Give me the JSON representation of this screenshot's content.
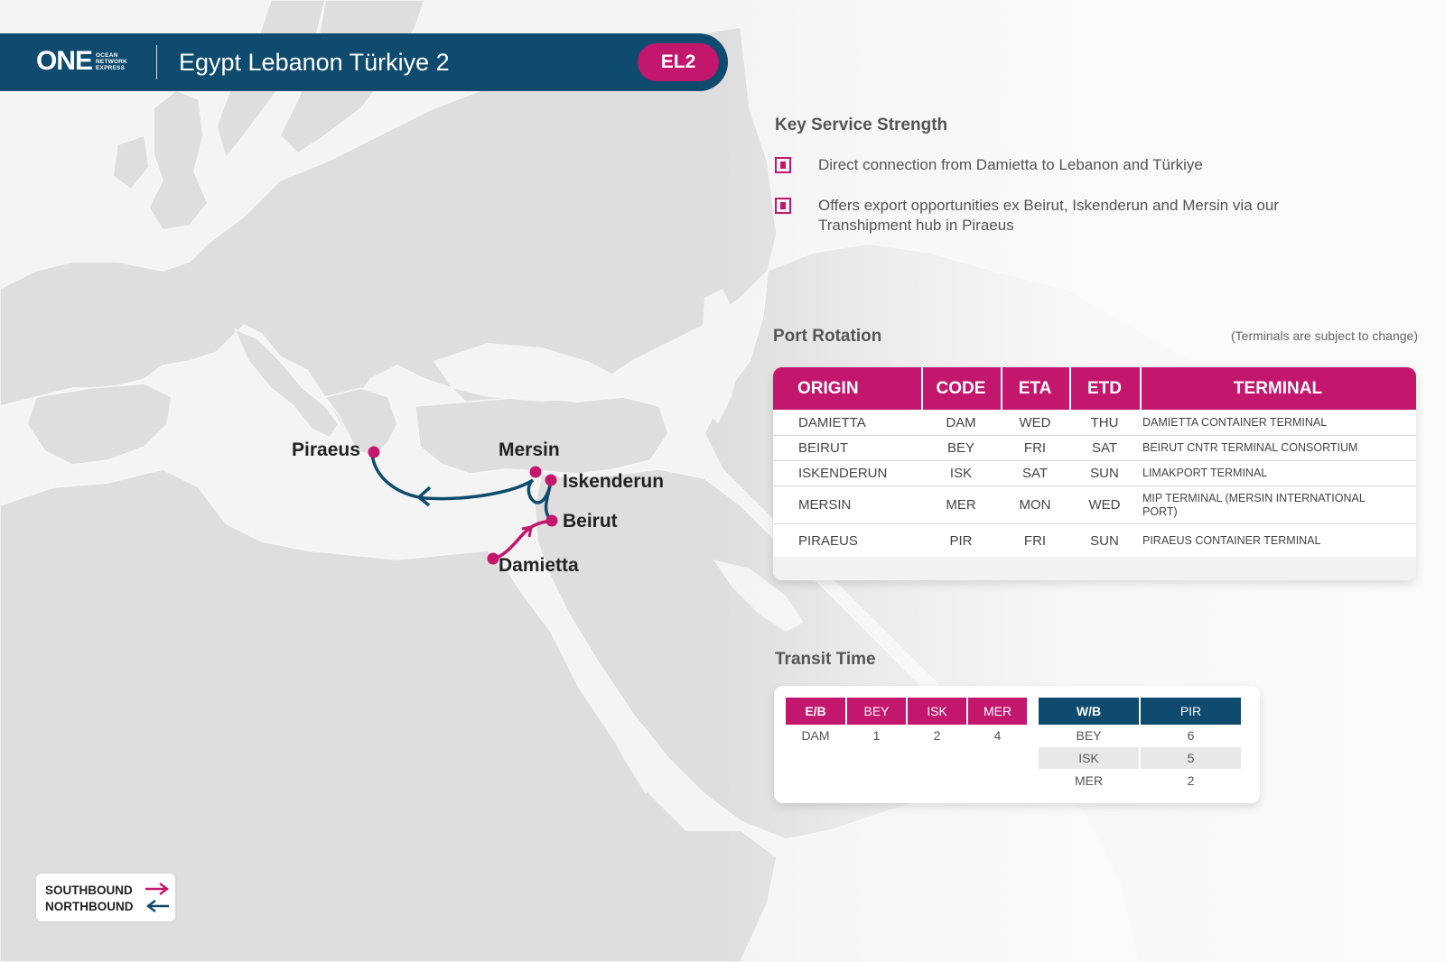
{
  "header": {
    "logo_main": "ONE",
    "logo_sub": [
      "OCEAN",
      "NETWORK",
      "EXPRESS"
    ],
    "service_name": "Egypt Lebanon Türkiye 2",
    "service_code": "EL2"
  },
  "key_strength": {
    "title": "Key Service Strength",
    "items": [
      "Direct connection from Damietta to Lebanon and Türkiye",
      "Offers export opportunities ex Beirut, Iskenderun and Mersin via our Transhipment hub in Piraeus"
    ]
  },
  "port_rotation": {
    "title": "Port Rotation",
    "note": "(Terminals are subject to change)",
    "headers": [
      "ORIGIN",
      "CODE",
      "ETA",
      "ETD",
      "TERMINAL"
    ],
    "rows": [
      [
        "DAMIETTA",
        "DAM",
        "WED",
        "THU",
        "DAMIETTA CONTAINER TERMINAL"
      ],
      [
        "BEIRUT",
        "BEY",
        "FRI",
        "SAT",
        "BEIRUT CNTR TERMINAL CONSORTIUM"
      ],
      [
        "ISKENDERUN",
        "ISK",
        "SAT",
        "SUN",
        "LIMAKPORT TERMINAL"
      ],
      [
        "MERSIN",
        "MER",
        "MON",
        "WED",
        "MIP TERMINAL (MERSIN INTERNATIONAL PORT)"
      ],
      [
        "PIRAEUS",
        "PIR",
        "FRI",
        "SUN",
        "PIRAEUS CONTAINER TERMINAL"
      ]
    ]
  },
  "transit_time": {
    "title": "Transit Time",
    "eastbound": {
      "headers": [
        "E/B",
        "BEY",
        "ISK",
        "MER"
      ],
      "rows": [
        [
          "DAM",
          "1",
          "2",
          "4"
        ]
      ]
    },
    "westbound": {
      "headers": [
        "W/B",
        "PIR"
      ],
      "rows": [
        [
          "BEY",
          "6"
        ],
        [
          "ISK",
          "5"
        ],
        [
          "MER",
          "2"
        ]
      ]
    }
  },
  "map": {
    "ports": [
      "Piraeus",
      "Mersin",
      "Iskenderun",
      "Beirut",
      "Damietta"
    ],
    "southbound_color": "#c2176c",
    "northbound_color": "#0f4b6e"
  },
  "legend": {
    "southbound": "SOUTHBOUND",
    "northbound": "NORTHBOUND"
  },
  "colors": {
    "brand_navy": "#0f4b6e",
    "brand_magenta": "#c2176c"
  }
}
